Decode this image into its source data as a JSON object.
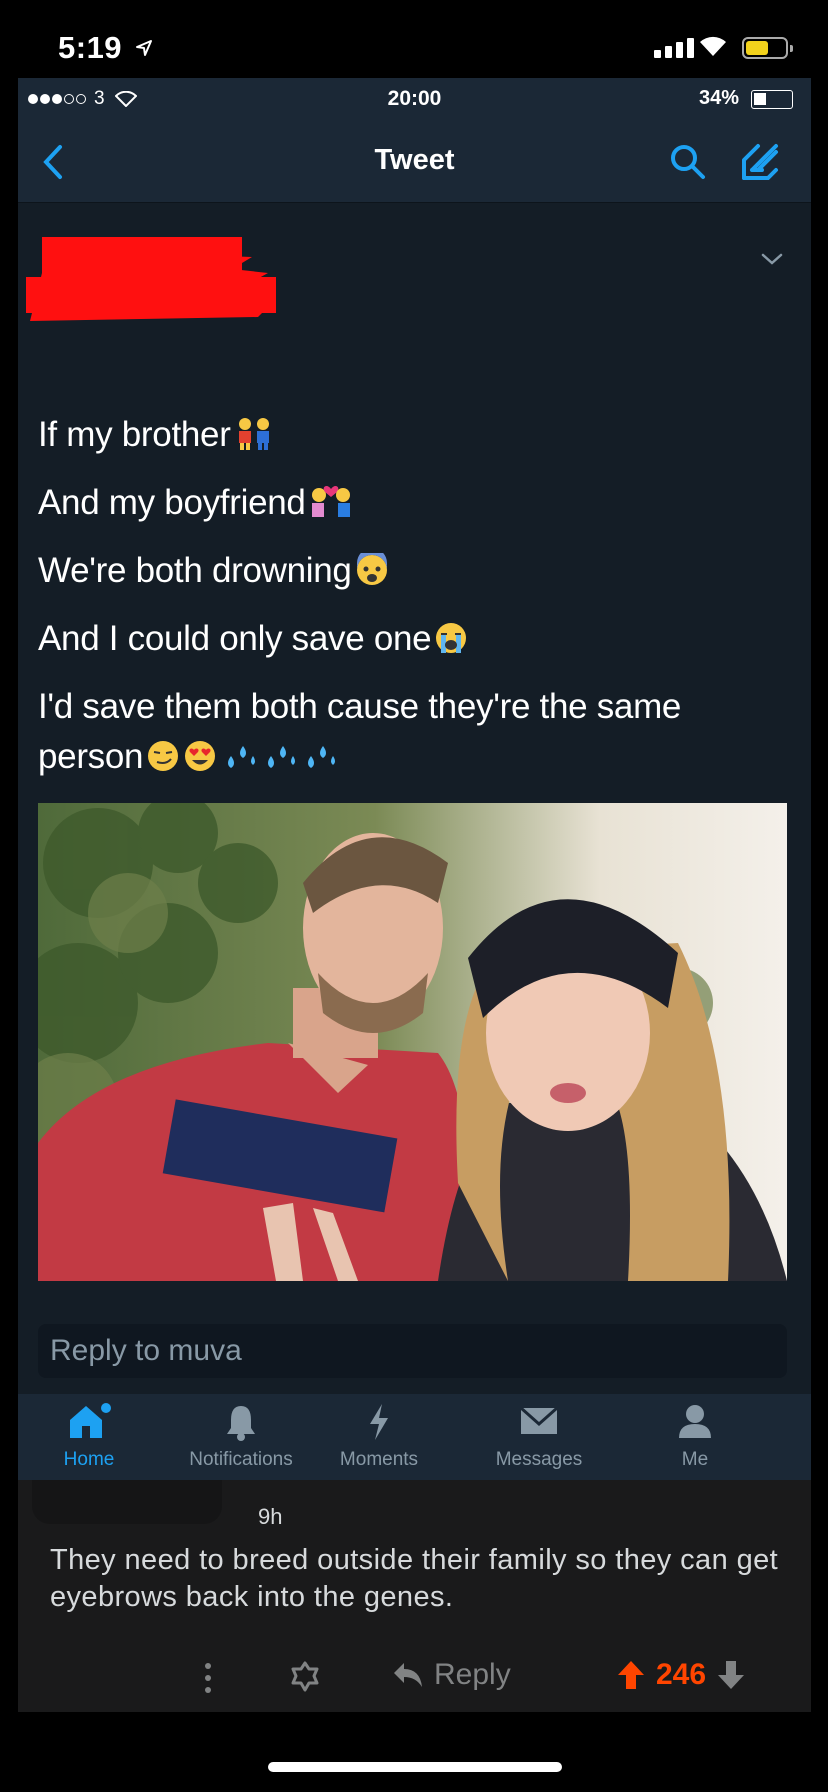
{
  "device_status": {
    "time": "5:19",
    "battery_color": "#f2d21c"
  },
  "app_status": {
    "carrier_num": "3",
    "time": "20:00",
    "battery": "34%"
  },
  "nav": {
    "title": "Tweet"
  },
  "tweet": {
    "lines": [
      "If my brother",
      "And my boyfriend",
      "We're both drowning",
      "And I could only save one",
      "I'd save them both cause they're the same",
      "person"
    ]
  },
  "reply": {
    "placeholder": "Reply to muva"
  },
  "tabs": [
    {
      "label": "Home",
      "icon": "home-icon",
      "active": true
    },
    {
      "label": "Notifications",
      "icon": "bell-icon"
    },
    {
      "label": "Moments",
      "icon": "lightning-icon"
    },
    {
      "label": "Messages",
      "icon": "envelope-icon"
    },
    {
      "label": "Me",
      "icon": "person-icon"
    }
  ],
  "comment": {
    "time": "9h",
    "text": "They need to breed outside their family so they can get eyebrows back into the genes.",
    "reply_label": "Reply",
    "score": "246"
  },
  "colors": {
    "twitter_bg": "#141d26",
    "twitter_bar": "#1b2836",
    "accent": "#1da1f2",
    "upvote": "#ff4500"
  }
}
